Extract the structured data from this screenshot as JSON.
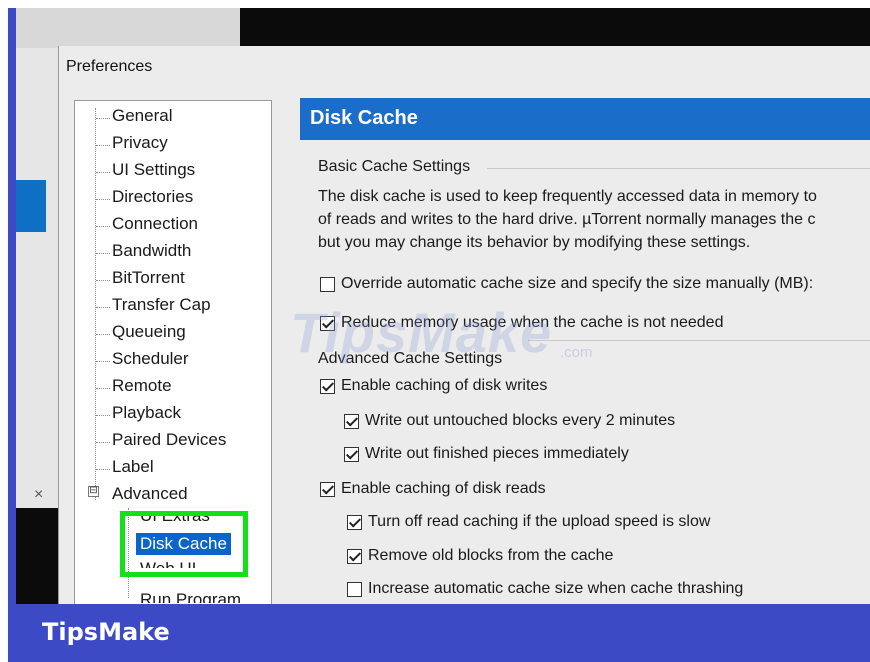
{
  "dialog": {
    "title": "Preferences"
  },
  "tree": {
    "items": [
      "General",
      "Privacy",
      "UI Settings",
      "Directories",
      "Connection",
      "Bandwidth",
      "BitTorrent",
      "Transfer Cap",
      "Queueing",
      "Scheduler",
      "Remote",
      "Playback",
      "Paired Devices",
      "Label",
      "Advanced"
    ],
    "expander": "⊟",
    "children": {
      "above": "UI Extras",
      "selected": "Disk Cache",
      "below": "Web UI",
      "next": "Run Program"
    }
  },
  "panel": {
    "title": "Disk Cache",
    "basic": {
      "label": "Basic Cache Settings",
      "desc": [
        "The disk cache is used to keep frequently accessed data in memory to",
        "of reads and writes to the hard drive. µTorrent normally manages the c",
        "but you may change its behavior by modifying these settings."
      ],
      "override": {
        "label": "Override automatic cache size and specify the size manually (MB):",
        "checked": false
      },
      "reduce": {
        "label": "Reduce memory usage when the cache is not needed",
        "checked": true
      }
    },
    "advanced": {
      "label": "Advanced Cache Settings",
      "options": [
        {
          "label": "Enable caching of disk writes",
          "checked": true
        },
        {
          "label": "Write out untouched blocks every 2 minutes",
          "checked": true
        },
        {
          "label": "Write out finished pieces immediately",
          "checked": true
        },
        {
          "label": "Enable caching of disk reads",
          "checked": true
        },
        {
          "label": "Turn off read caching if the upload speed is slow",
          "checked": true
        },
        {
          "label": "Remove old blocks from the cache",
          "checked": true
        },
        {
          "label": "Increase automatic cache size when cache thrashing",
          "checked": false
        }
      ]
    }
  },
  "left_window": {
    "close_glyph": "×"
  },
  "watermark": {
    "text": "TipsMake",
    "suffix": ".com"
  },
  "footer": {
    "brand": "TipsMake"
  },
  "colors": {
    "header_blue": "#1a6ec9",
    "selection_blue": "#0a64c9",
    "highlight_green": "#14e01a",
    "footer_blue": "#3d4ac6"
  }
}
